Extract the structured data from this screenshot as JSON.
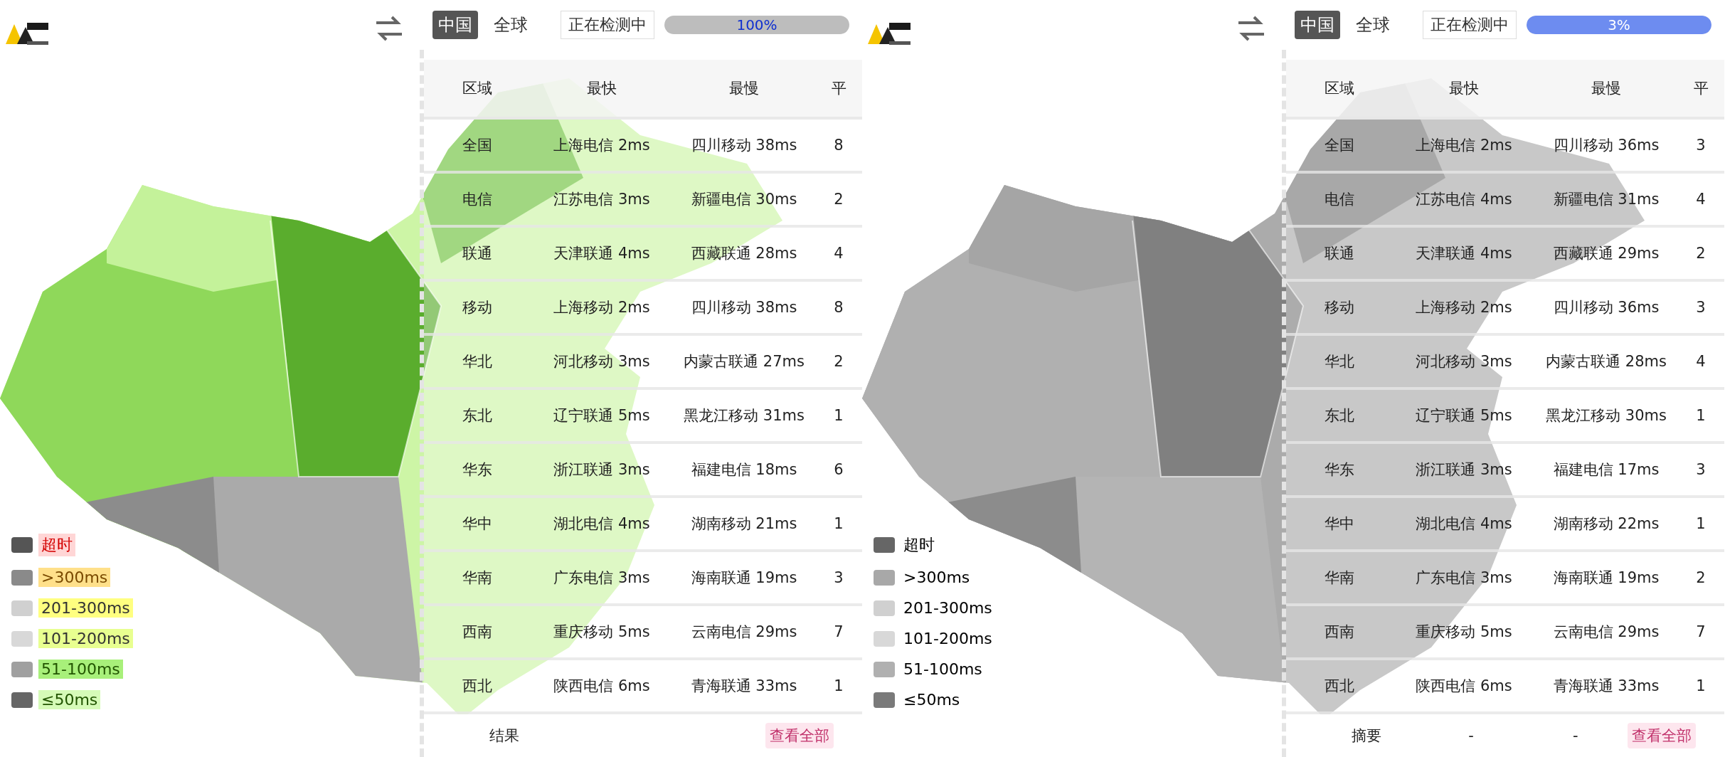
{
  "panes": [
    {
      "map": {
        "kind": "green"
      },
      "toolbar": {
        "tabs": [
          {
            "label": "中国",
            "selected": true
          },
          {
            "label": "全球",
            "selected": false
          }
        ],
        "status": "正在检测中",
        "progress": {
          "level": 1,
          "reading": "100%",
          "kind": "gray"
        }
      },
      "legend": [
        {
          "label": "超时",
          "color": "#555555",
          "kind": "timeout"
        },
        {
          "label": ">300ms",
          "color": "#8a8a8a",
          "kind": "slow"
        },
        {
          "label": "201-300ms",
          "color": "#d0d0d0",
          "kind": "medium"
        },
        {
          "label": "101-200ms",
          "color": "#d8d8d8",
          "kind": "fair"
        },
        {
          "label": "51-100ms",
          "color": "#a0a0a0",
          "kind": "good"
        },
        {
          "label": "≤50ms",
          "color": "#666666",
          "kind": "fast"
        }
      ],
      "table": {
        "columns": [
          "区域",
          "最快",
          "最慢",
          "平"
        ],
        "rows": [
          [
            "全国",
            "上海电信 2ms",
            "四川移动 38ms",
            "8"
          ],
          [
            "电信",
            "江苏电信 3ms",
            "新疆电信 30ms",
            "2"
          ],
          [
            "联通",
            "天津联通 4ms",
            "西藏联通 28ms",
            "4"
          ],
          [
            "移动",
            "上海移动 2ms",
            "四川移动 38ms",
            "8"
          ],
          [
            "华北",
            "河北移动 3ms",
            "内蒙古联通 27ms",
            "2"
          ],
          [
            "东北",
            "辽宁联通 5ms",
            "黑龙江移动 31ms",
            "1"
          ],
          [
            "华东",
            "浙江联通 3ms",
            "福建电信 18ms",
            "6"
          ],
          [
            "华中",
            "湖北电信 4ms",
            "湖南移动 21ms",
            "1"
          ],
          [
            "华南",
            "广东电信 3ms",
            "海南联通 19ms",
            "3"
          ],
          [
            "西南",
            "重庆移动 5ms",
            "云南电信 29ms",
            "7"
          ],
          [
            "西北",
            "陕西电信 6ms",
            "青海联通 33ms",
            "1"
          ]
        ],
        "footer": {
          "label": "结果",
          "button": "查看全部"
        }
      }
    },
    {
      "map": {
        "kind": "gray"
      },
      "toolbar": {
        "tabs": [
          {
            "label": "中国",
            "selected": true
          },
          {
            "label": "全球",
            "selected": false
          }
        ],
        "status": "正在检测中",
        "progress": {
          "level": 1,
          "reading": "3%",
          "kind": "blue"
        }
      },
      "legend": [
        {
          "label": "超时",
          "color": "#666666"
        },
        {
          "label": ">300ms",
          "color": "#a8a8a8"
        },
        {
          "label": "201-300ms",
          "color": "#d0d0d0"
        },
        {
          "label": "101-200ms",
          "color": "#d8d8d8"
        },
        {
          "label": "51-100ms",
          "color": "#b0b0b0"
        },
        {
          "label": "≤50ms",
          "color": "#7a7a7a"
        }
      ],
      "table": {
        "columns": [
          "区域",
          "最快",
          "最慢",
          "平"
        ],
        "rows": [
          [
            "全国",
            "上海电信 2ms",
            "四川移动 36ms",
            "3"
          ],
          [
            "电信",
            "江苏电信 4ms",
            "新疆电信 31ms",
            "4"
          ],
          [
            "联通",
            "天津联通 4ms",
            "西藏联通 29ms",
            "2"
          ],
          [
            "移动",
            "上海移动 2ms",
            "四川移动 36ms",
            "3"
          ],
          [
            "华北",
            "河北移动 3ms",
            "内蒙古联通 28ms",
            "4"
          ],
          [
            "东北",
            "辽宁联通 5ms",
            "黑龙江移动 30ms",
            "1"
          ],
          [
            "华东",
            "浙江联通 3ms",
            "福建电信 17ms",
            "3"
          ],
          [
            "华中",
            "湖北电信 4ms",
            "湖南移动 22ms",
            "1"
          ],
          [
            "华南",
            "广东电信 3ms",
            "海南联通 19ms",
            "2"
          ],
          [
            "西南",
            "重庆移动 5ms",
            "云南电信 29ms",
            "7"
          ],
          [
            "西北",
            "陕西电信 6ms",
            "青海联通 33ms",
            "1"
          ]
        ],
        "footer": {
          "label": "摘要",
          "cells": [
            "-",
            "-"
          ],
          "button": "查看全部"
        }
      }
    }
  ]
}
